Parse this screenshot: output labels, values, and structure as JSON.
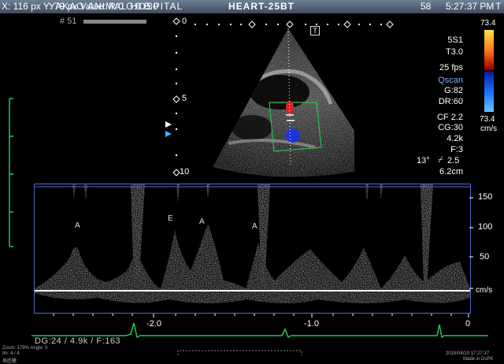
{
  "header": {
    "cursor_readout": "X: 116 px Y: 79 px Value: R:0 G:0 B:0",
    "hospital": "YAKAO ANIMAL HOSPITAL",
    "exam_id": "HEART-25BT",
    "frame_count": "58",
    "clock": "5:27:37 PM",
    "cine_marker": "T",
    "frame_number": "# 51"
  },
  "image_panel": {
    "depth_marks": [
      "0",
      "5",
      "10"
    ],
    "probe_marker": "T"
  },
  "settings": {
    "probe": "5S1",
    "harmonic": "T3.0",
    "fps": "25 fps",
    "qscan": "Qscan",
    "gain": "G:82",
    "dynamic_range": "DR:60",
    "cf_freq": "CF 2.2",
    "cf_gain": "CG:30",
    "prf": "4.2k",
    "filter": "F:3",
    "angle": "13°",
    "angle_correction": "2.5",
    "depth": "6.2cm",
    "colorbar_max": "73.4",
    "colorbar_min": "73.4",
    "colorbar_unit": "cm/s",
    "colorbar_colors": [
      "#ffe24a",
      "#ff7a1a",
      "#a00000",
      "#0a20a0",
      "#1a6cff",
      "#63c6ff"
    ]
  },
  "doppler": {
    "velocity_scale": [
      "150",
      "100",
      "50",
      "cm/s"
    ],
    "time_scale": [
      "-2.0",
      "-1.0",
      "0"
    ],
    "peak_labels": [
      "A",
      "E",
      "A",
      "A"
    ],
    "accent_color": "#5868c8",
    "ecg_color": "#27c45a"
  },
  "footer": {
    "params": "DG:24  / 4.9k  / F:163",
    "zoom": "Zoom: 179%  Angle: 0",
    "line2": "Im: 4 / 4",
    "line3": "寿匠騰",
    "date": "2015/04/10 17:27:37",
    "made_in": "Made in DsPK"
  }
}
